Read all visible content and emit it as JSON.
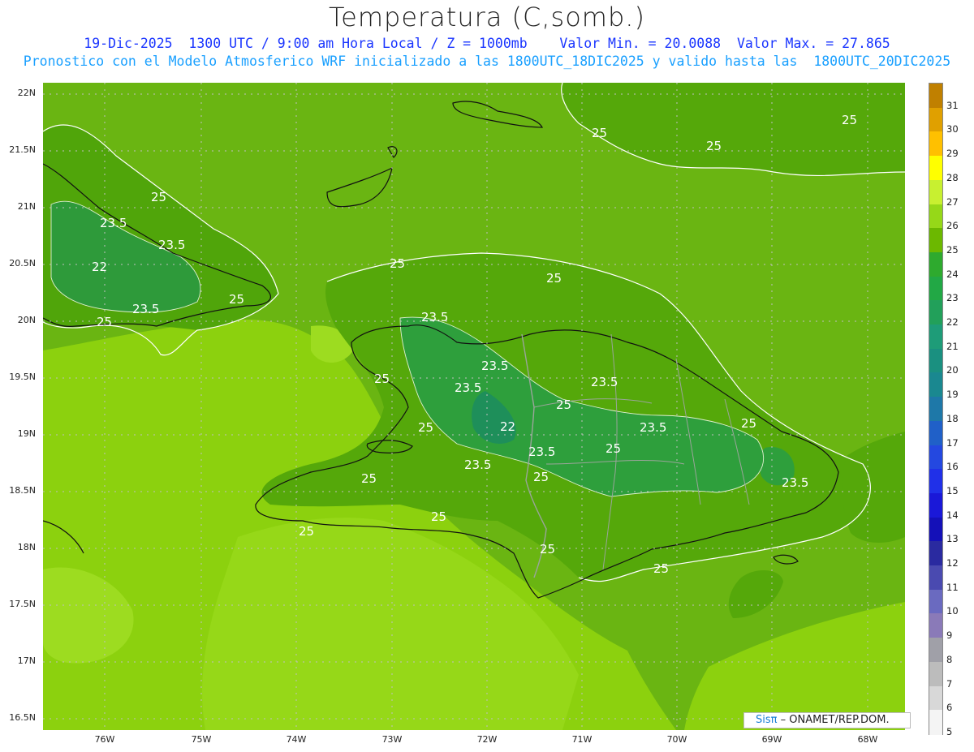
{
  "header": {
    "title": "Temperatura (C,somb.)",
    "line1": "19-Dic-2025  1300 UTC / 9:00 am Hora Local / Z = 1000mb    Valor Min. = 20.0088  Valor Max. = 27.865",
    "line2": "Pronostico con el Modelo Atmosferico WRF inicializado a las 1800UTC_18DIC2025 y valido hasta las  1800UTC_20DIC2025"
  },
  "axes": {
    "lat_labels": [
      "22N",
      "21.5N",
      "21N",
      "20.5N",
      "20N",
      "19.5N",
      "19N",
      "18.5N",
      "18N",
      "17.5N",
      "17N",
      "16.5N"
    ],
    "lon_labels": [
      "76W",
      "75W",
      "74W",
      "73W",
      "72W",
      "71W",
      "70W",
      "69W",
      "68W"
    ]
  },
  "legend": {
    "values": [
      "31",
      "30",
      "29",
      "28",
      "27",
      "26",
      "25",
      "24",
      "23",
      "22",
      "21",
      "20",
      "19",
      "18",
      "17",
      "16",
      "15",
      "14",
      "13",
      "12",
      "11",
      "10",
      "9",
      "8",
      "7",
      "6",
      "5"
    ],
    "colors": [
      "#c08000",
      "#e0a000",
      "#ffc000",
      "#ffff00",
      "#c8f030",
      "#96d818",
      "#6cb800",
      "#2eaa2e",
      "#22a845",
      "#22a05a",
      "#1e9c78",
      "#1a9080",
      "#1a8890",
      "#1e78a8",
      "#2060c8",
      "#2448e0",
      "#2030e8",
      "#1a18d8",
      "#1410b8",
      "#2a2aa0",
      "#4a4ab0",
      "#6a6ac0",
      "#8a7ab8",
      "#a0a0a8",
      "#bcbcbc",
      "#d8d8d8",
      "#f4f4f4"
    ]
  },
  "contour_labels": [
    "25",
    "25",
    "25",
    "25",
    "25",
    "25",
    "23.5",
    "23.5",
    "23.5",
    "22",
    "25",
    "25",
    "23.5",
    "23.5",
    "23.5",
    "22",
    "23.5",
    "25",
    "25",
    "25",
    "23.5",
    "23.5",
    "23.5",
    "25",
    "25",
    "25",
    "25",
    "25",
    "25",
    "23.5",
    "25",
    "25"
  ],
  "credit": {
    "sis": "Sisπ",
    "rest": " –  ONAMET/REP.DOM."
  }
}
